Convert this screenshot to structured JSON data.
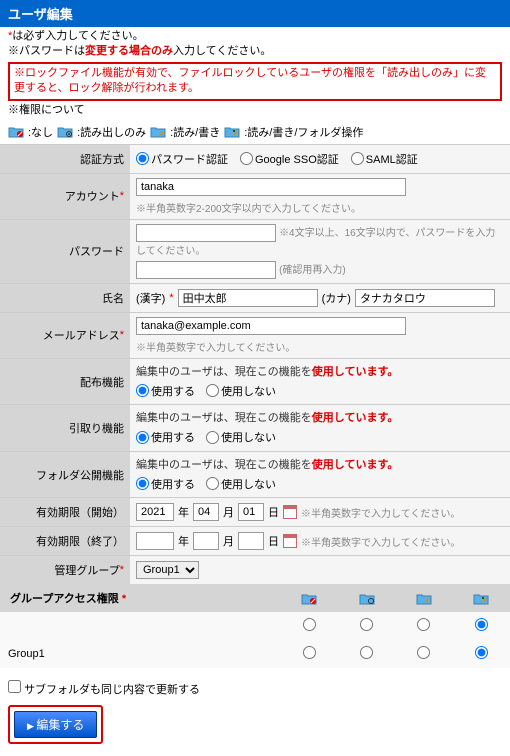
{
  "header": {
    "title": "ユーザ編集"
  },
  "notices": {
    "required": "は必ず入力してください。",
    "required_mark": "*",
    "pwd_note_pre": "※パスワードは",
    "pwd_note_em": "変更する場合のみ",
    "pwd_note_post": "入力してください。",
    "lock_note": "※ロックファイル機能が有効で、ファイルロックしているユーザの権限を「読み出しのみ」に変更すると、ロック解除が行われます。",
    "perm_title": "※権限について"
  },
  "perm_legend": {
    "none": ":なし",
    "read": ":読み出しのみ",
    "rw": ":読み/書き",
    "rwf": ":読み/書き/フォルダ操作"
  },
  "form": {
    "auth": {
      "label": "認証方式",
      "opts": [
        "パスワード認証",
        "Google SSO認証",
        "SAML認証"
      ],
      "selected": 0
    },
    "account": {
      "label": "アカウント",
      "value": "tanaka",
      "hint": "※半角英数字2-200文字以内で入力してください。"
    },
    "password": {
      "label": "パスワード",
      "hint1": "※4文字以上、16文字以内で、パスワードを入力してください。",
      "hint2": "(確認用再入力)"
    },
    "name": {
      "label": "氏名",
      "kanji_lbl": "(漢字)",
      "kanji_val": "田中太郎",
      "kana_lbl": "(カナ)",
      "kana_val": "タナカタロウ"
    },
    "email": {
      "label": "メールアドレス",
      "value": "tanaka@example.com",
      "hint": "※半角英数字で入力してください。"
    },
    "dist": {
      "label": "配布機能",
      "msg_pre": "編集中のユーザは、現在この機能を",
      "msg_em": "使用しています。",
      "use": "使用する",
      "nouse": "使用しない"
    },
    "pickup": {
      "label": "引取り機能",
      "msg_pre": "編集中のユーザは、現在この機能を",
      "msg_em": "使用しています。",
      "use": "使用する",
      "nouse": "使用しない"
    },
    "folder_pub": {
      "label": "フォルダ公開機能",
      "msg_pre": "編集中のユーザは、現在この機能を",
      "msg_em": "使用しています。",
      "use": "使用する",
      "nouse": "使用しない"
    },
    "valid_start": {
      "label": "有効期限（開始）",
      "y": "2021",
      "y_lbl": "年",
      "m": "04",
      "m_lbl": "月",
      "d": "01",
      "d_lbl": "日",
      "hint": "※半角英数字で入力してください。"
    },
    "valid_end": {
      "label": "有効期限（終了）",
      "y": "",
      "y_lbl": "年",
      "m": "",
      "m_lbl": "月",
      "d": "",
      "d_lbl": "日",
      "hint": "※半角英数字で入力してください。"
    },
    "mgmt_group": {
      "label": "管理グループ",
      "value": "Group1"
    }
  },
  "group_access": {
    "header": "グループアクセス権限",
    "rows": [
      {
        "name": "",
        "sel": 3
      },
      {
        "name": "Group1",
        "sel": 3
      }
    ]
  },
  "footer": {
    "subfolder_cb": "サブフォルダも同じ内容で更新する",
    "submit": "編集する"
  },
  "asterisk": "*"
}
